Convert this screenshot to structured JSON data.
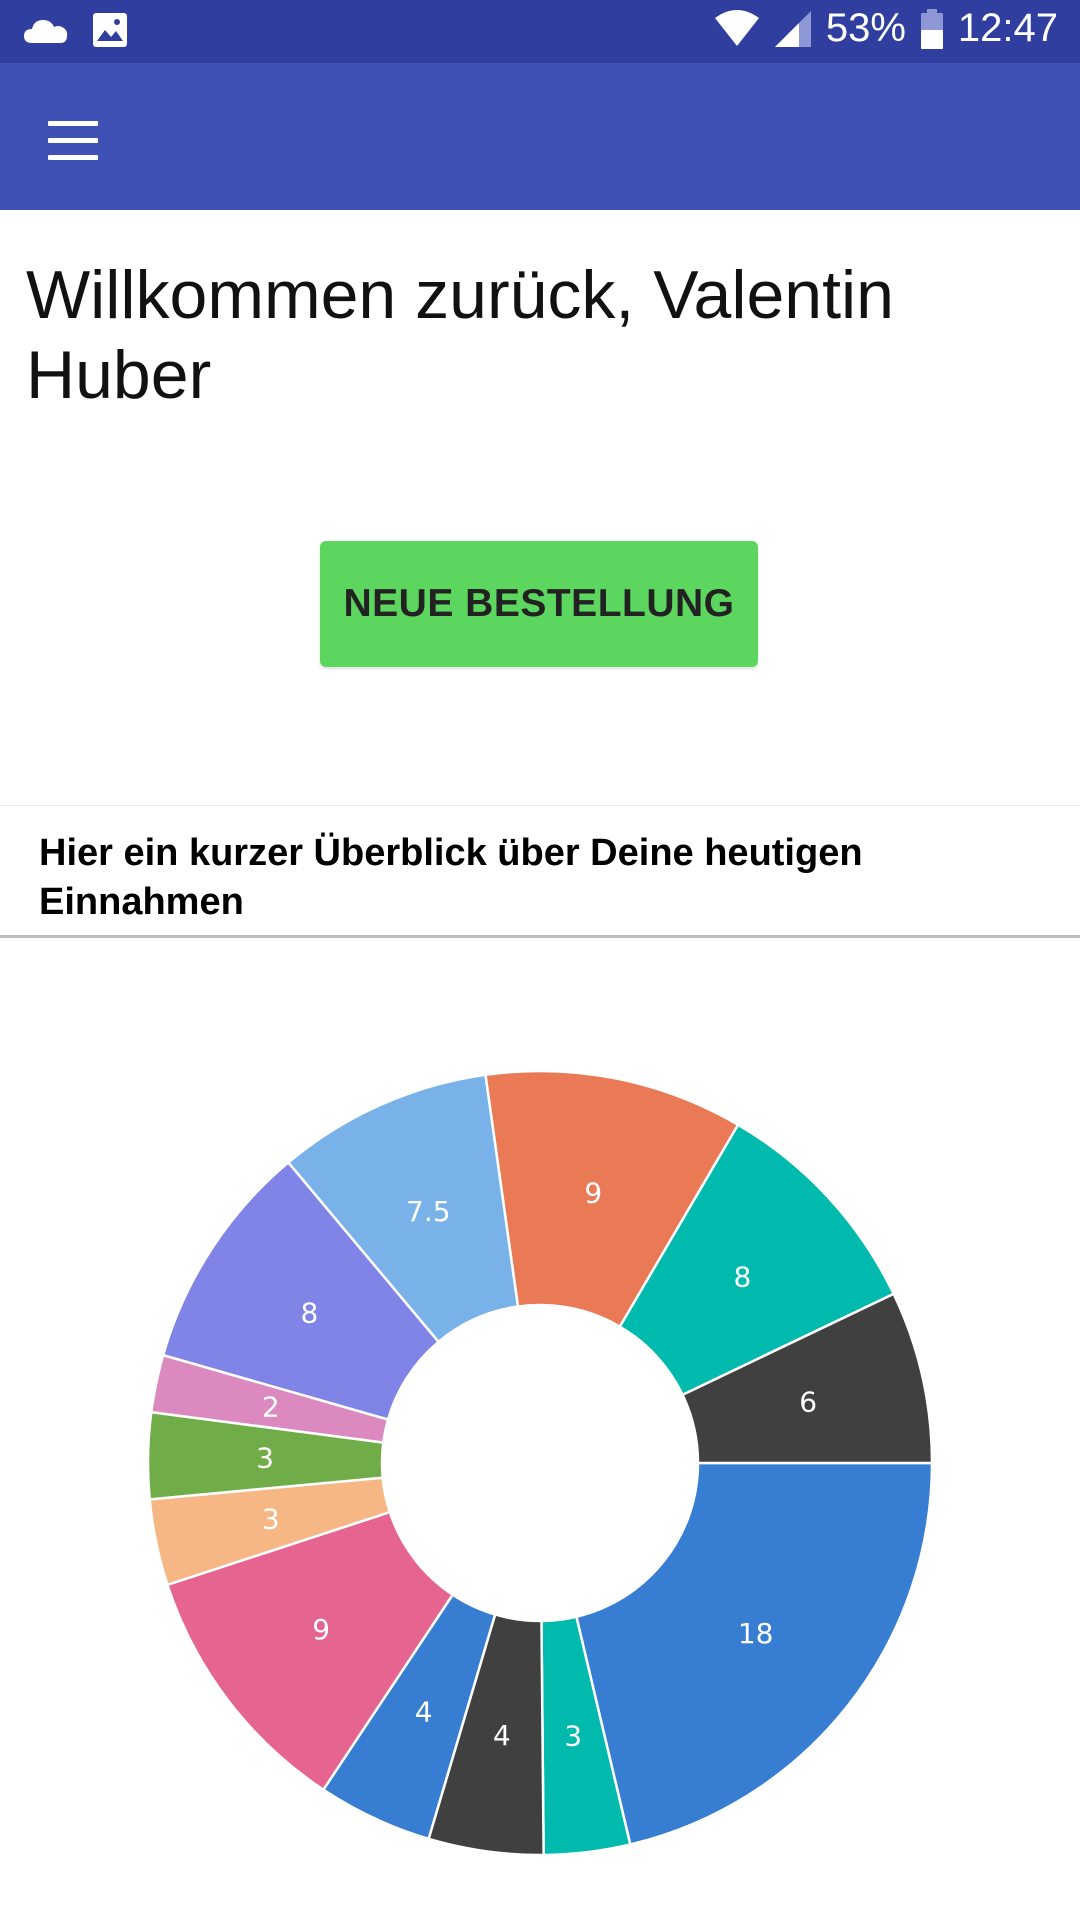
{
  "status_bar": {
    "battery": "53%",
    "time": "12:47",
    "icons": [
      "cloud-icon",
      "image-icon",
      "wifi-icon",
      "signal-icon",
      "battery-icon"
    ]
  },
  "app_bar": {
    "menu_icon": "hamburger-menu-icon",
    "color": "#3f51b5",
    "status_color": "#303f9f"
  },
  "welcome": {
    "text": "Willkommen zurück, Valentin Huber"
  },
  "new_order_button": {
    "label": "NEUE BESTELLUNG",
    "color": "#5cd65f"
  },
  "overview": {
    "title": "Hier ein kurzer Überblick über Deine heutigen Einnahmen"
  },
  "chart_data": {
    "type": "pie",
    "donut": true,
    "values": [
      18,
      3,
      4,
      4,
      9,
      3,
      3,
      2,
      8,
      7.5,
      9,
      8,
      6
    ],
    "labels": [
      "18",
      "3",
      "4",
      "4",
      "9",
      "3",
      "3",
      "2",
      "8",
      "7.5",
      "9",
      "8",
      "6"
    ],
    "colors": [
      "#377dd2",
      "#00bbad",
      "#404040",
      "#377dd2",
      "#e56490",
      "#f7b784",
      "#70ac47",
      "#dc89bf",
      "#7f84e6",
      "#79b2e9",
      "#ea7956",
      "#00bbad",
      "#404040"
    ],
    "start": "3 o'clock",
    "direction": "clockwise",
    "legend": "none"
  }
}
